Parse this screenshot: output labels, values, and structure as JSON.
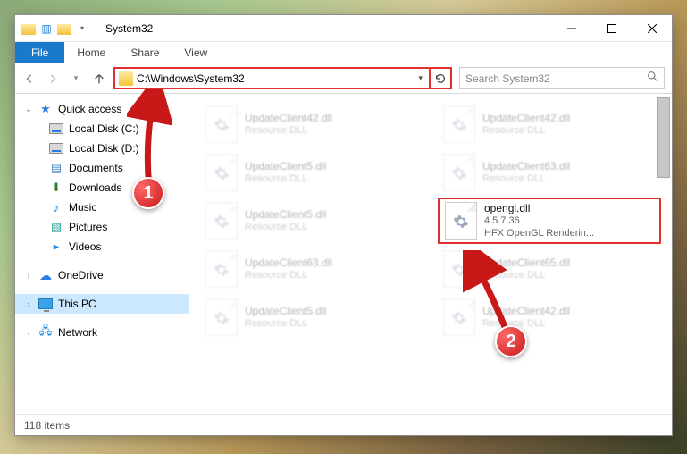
{
  "window": {
    "title": "System32"
  },
  "ribbon": {
    "file": "File",
    "tabs": [
      "Home",
      "Share",
      "View"
    ]
  },
  "address": {
    "path": "C:\\Windows\\System32"
  },
  "search": {
    "placeholder": "Search System32"
  },
  "sidebar": {
    "quick_access": {
      "label": "Quick access",
      "items": [
        {
          "label": "Local Disk (C:)",
          "icon": "disk"
        },
        {
          "label": "Local Disk (D:)",
          "icon": "disk"
        },
        {
          "label": "Documents",
          "icon": "docs"
        },
        {
          "label": "Downloads",
          "icon": "down"
        },
        {
          "label": "Music",
          "icon": "music"
        },
        {
          "label": "Pictures",
          "icon": "pics"
        },
        {
          "label": "Videos",
          "icon": "vids"
        }
      ]
    },
    "onedrive": {
      "label": "OneDrive"
    },
    "thispc": {
      "label": "This PC"
    },
    "network": {
      "label": "Network"
    }
  },
  "files": [
    {
      "name": "UpdateClient42.dll",
      "sub1": "Resource DLL",
      "sub2": ""
    },
    {
      "name": "UpdateClient42.dll",
      "sub1": "Resource DLL",
      "sub2": ""
    },
    {
      "name": "UpdateClient5.dll",
      "sub1": "Resource DLL",
      "sub2": ""
    },
    {
      "name": "UpdateClient63.dll",
      "sub1": "Resource DLL",
      "sub2": ""
    },
    {
      "name": "UpdateClient5.dll",
      "sub1": "Resource DLL",
      "sub2": ""
    },
    {
      "name": "opengl.dll",
      "sub1": "4.5.7.36",
      "sub2": "HFX OpenGL Renderin...",
      "highlight": true
    },
    {
      "name": "UpdateClient63.dll",
      "sub1": "Resource DLL",
      "sub2": ""
    },
    {
      "name": "UpdateClient65.dll",
      "sub1": "Resource DLL",
      "sub2": ""
    },
    {
      "name": "UpdateClient5.dll",
      "sub1": "Resource DLL",
      "sub2": ""
    },
    {
      "name": "UpdateClient42.dll",
      "sub1": "Resource DLL",
      "sub2": ""
    }
  ],
  "status": {
    "count": "118 items"
  },
  "callouts": {
    "one": "1",
    "two": "2"
  }
}
